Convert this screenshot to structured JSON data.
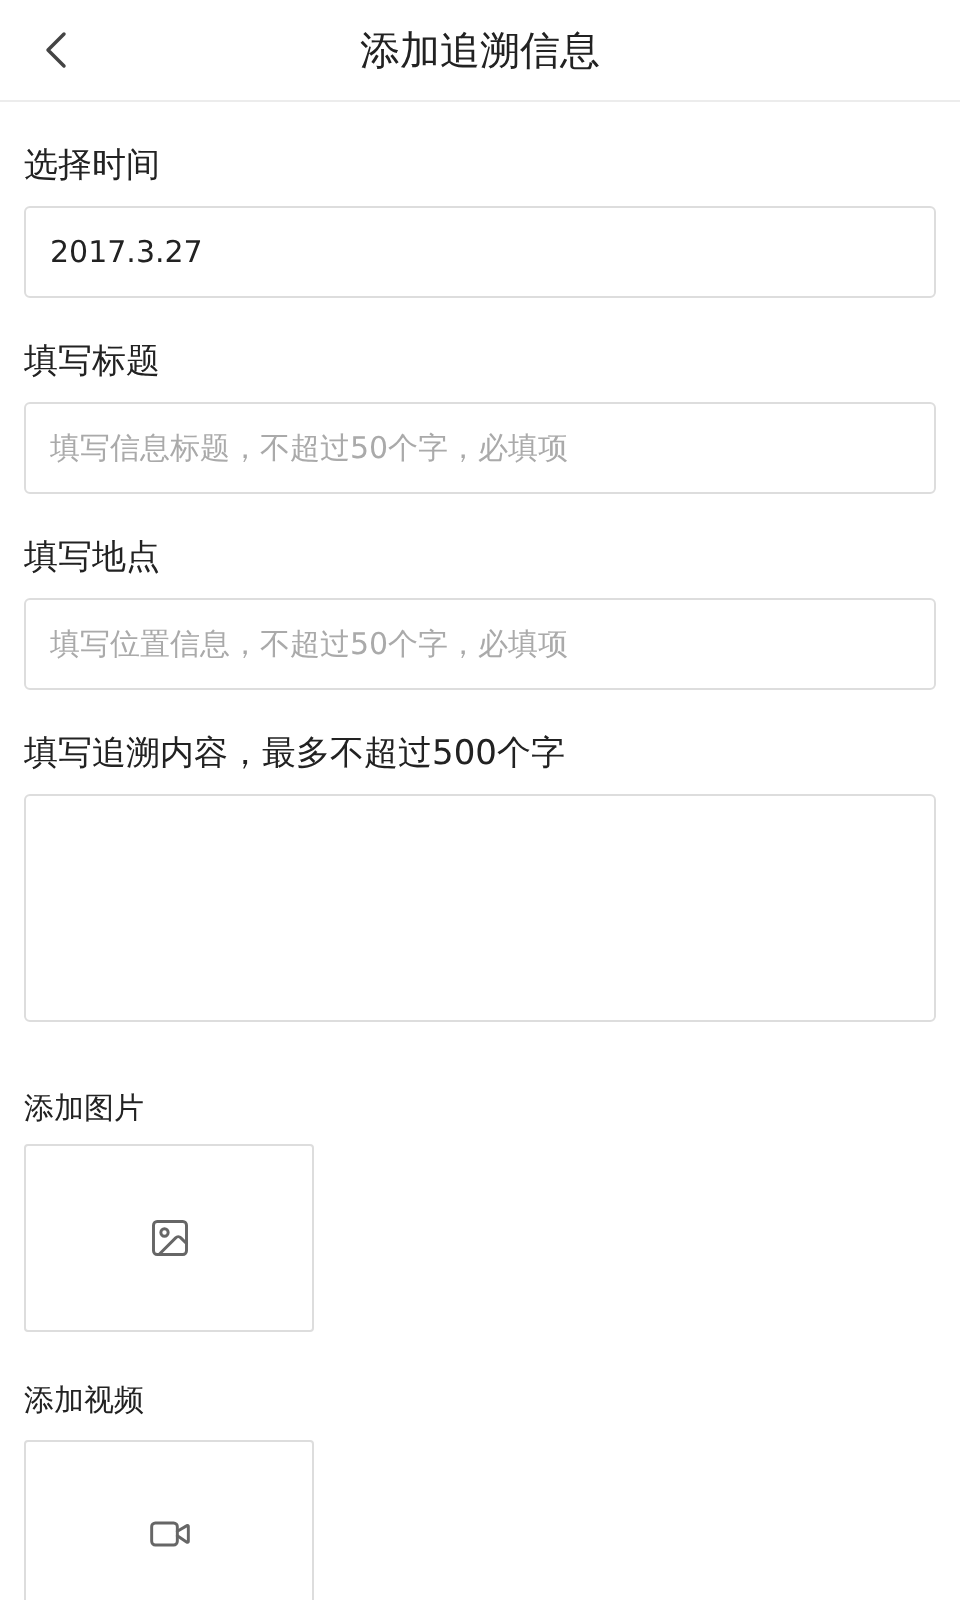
{
  "header": {
    "title": "添加追溯信息"
  },
  "fields": [
    {
      "kind": "input",
      "label": "选择时间",
      "value": "2017.3.27"
    },
    {
      "kind": "input",
      "label": "填写标题",
      "placeholder": "填写信息标题，不超过50个字，必填项"
    },
    {
      "kind": "input",
      "label": "填写地点",
      "placeholder": "填写位置信息，不超过50个字，必填项"
    },
    {
      "kind": "textarea",
      "label": "填写追溯内容，最多不超过500个字"
    }
  ],
  "media": [
    {
      "kind": "image",
      "label": "添加图片"
    },
    {
      "kind": "video",
      "label": "添加视频"
    }
  ]
}
